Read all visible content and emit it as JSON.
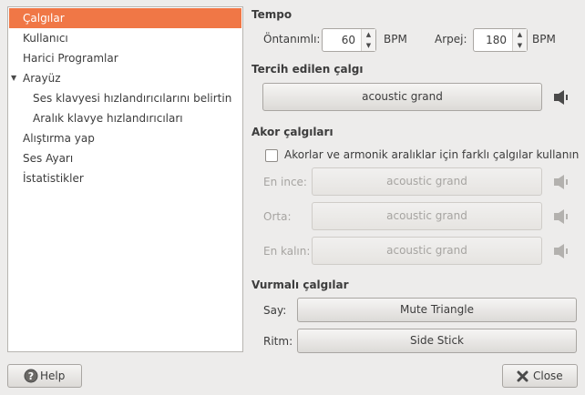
{
  "sidebar": {
    "items": [
      {
        "label": "Çalgılar",
        "selected": true,
        "indent": 0
      },
      {
        "label": "Kullanıcı",
        "indent": 0
      },
      {
        "label": "Harici Programlar",
        "indent": 0
      },
      {
        "label": "Arayüz",
        "indent": 0,
        "expanded": true
      },
      {
        "label": "Ses klavyesi hızlandırıcılarını belirtin",
        "indent": 1
      },
      {
        "label": "Aralık klavye hızlandırıcıları",
        "indent": 1
      },
      {
        "label": "Alıştırma yap",
        "indent": 0
      },
      {
        "label": "Ses Ayarı",
        "indent": 0
      },
      {
        "label": "İstatistikler",
        "indent": 0
      }
    ]
  },
  "tempo": {
    "title": "Tempo",
    "default_label": "Öntanımlı:",
    "default_value": "60",
    "default_unit": "BPM",
    "arpeggio_label": "Arpej:",
    "arpeggio_value": "180",
    "arpeggio_unit": "BPM"
  },
  "preferred": {
    "title": "Tercih edilen çalgı",
    "instrument": "acoustic grand"
  },
  "chord": {
    "title": "Akor çalgıları",
    "checkbox_label": "Akorlar ve armonik aralıklar için farklı çalgılar kullanın",
    "checked": false,
    "rows": [
      {
        "label": "En ince:",
        "instrument": "acoustic grand"
      },
      {
        "label": "Orta:",
        "instrument": "acoustic grand"
      },
      {
        "label": "En kalın:",
        "instrument": "acoustic grand"
      }
    ]
  },
  "percussion": {
    "title": "Vurmalı çalgılar",
    "count_label": "Say:",
    "count_instrument": "Mute Triangle",
    "rhythm_label": "Ritm:",
    "rhythm_instrument": "Side Stick"
  },
  "footer": {
    "help_label": "Help",
    "close_label": "Close"
  },
  "colors": {
    "selection": "#f07746",
    "window_bg": "#edeceb"
  }
}
